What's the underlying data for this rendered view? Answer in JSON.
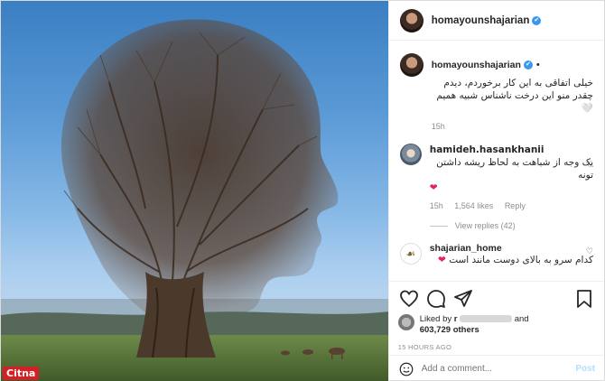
{
  "post": {
    "username": "homayounshajarian",
    "verified_mark": "✔",
    "dot": "•",
    "caption": "خیلی اتفاقی به این کار برخوردم، دیدم چقدر منو این درخت ناشناس شبیه همیم",
    "caption_emoji": "🤍",
    "caption_time": "15h"
  },
  "comments": [
    {
      "username": "hamideh.hasankhanii",
      "text": "یک وجه از شباهت به لحاظ ریشه داشتن تونه",
      "emoji": "❤",
      "time": "15h",
      "likes": "1,564 likes",
      "reply": "Reply",
      "view_replies": "View replies (42)"
    },
    {
      "username": "shajarian_home",
      "text": "کدام سرو به بالای دوست مانند است",
      "emoji": "❤"
    }
  ],
  "actions": {
    "liked_by_prefix": "Liked by",
    "liked_by_user": "r",
    "liked_and": "and",
    "likes_count": "603,729 others",
    "timestamp": "15 HOURS AGO",
    "comment_placeholder": "Add a comment...",
    "post_button": "Post"
  },
  "watermark": "Citna",
  "colors": {
    "accent": "#3897f0",
    "heart": "#e0245e",
    "post_disabled": "#b2dffc"
  }
}
